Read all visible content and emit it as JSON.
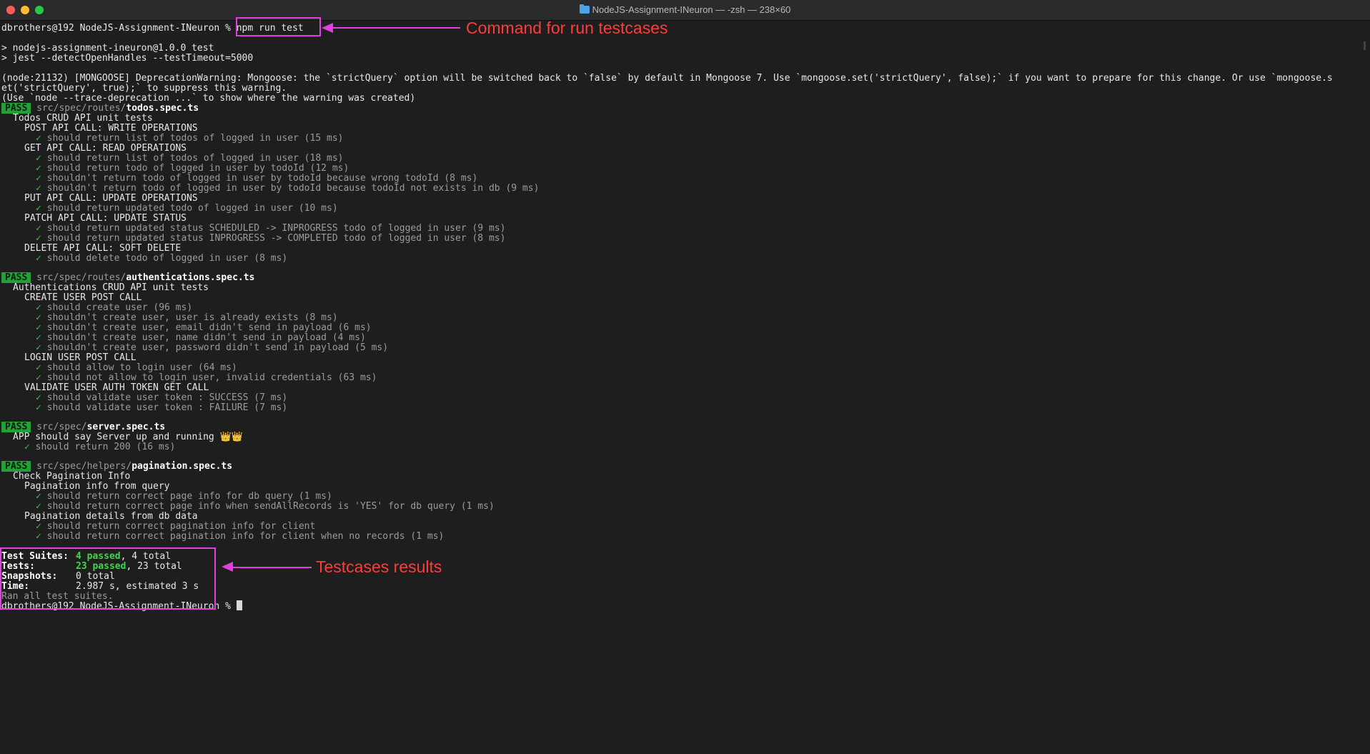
{
  "window": {
    "title": "NodeJS-Assignment-INeuron — -zsh — 238×60"
  },
  "prompt": {
    "text": "dbrothers@192 NodeJS-Assignment-INeuron % ",
    "command": "npm run test"
  },
  "output": {
    "line1": "> nodejs-assignment-ineuron@1.0.0 test",
    "line2": "> jest --detectOpenHandles --testTimeout=5000",
    "warning1": "(node:21132) [MONGOOSE] DeprecationWarning: Mongoose: the `strictQuery` option will be switched back to `false` by default in Mongoose 7. Use `mongoose.set('strictQuery', false);` if you want to prepare for this change. Or use `mongoose.s",
    "warning2": "et('strictQuery', true);` to suppress this warning.",
    "warning3": "(Use `node --trace-deprecation ...` to show where the warning was created)"
  },
  "pass_label": "PASS",
  "check": "✓",
  "suites": {
    "todos": {
      "dir": " src/spec/routes/",
      "file": "todos.spec.ts",
      "describe": "Todos CRUD API unit tests",
      "post": "POST API CALL: WRITE OPERATIONS",
      "post_t1": "should return list of todos of logged in user (15 ms)",
      "get": "GET API CALL: READ OPERATIONS",
      "get_t1": "should return list of todos of logged in user (18 ms)",
      "get_t2": "should return todo of logged in user by todoId (12 ms)",
      "get_t3": "shouldn't return todo of logged in user by todoId because wrong todoId (8 ms)",
      "get_t4": "shouldn't return todo of logged in user by todoId because todoId not exists in db (9 ms)",
      "put": "PUT API CALL: UPDATE OPERATIONS",
      "put_t1": "should return updated todo of logged in user (10 ms)",
      "patch": "PATCH API CALL: UPDATE STATUS",
      "patch_t1": "should return updated status SCHEDULED -> INPROGRESS todo of logged in user (9 ms)",
      "patch_t2": "should return updated status INPROGRESS -> COMPLETED todo of logged in user (8 ms)",
      "delete": "DELETE API CALL: SOFT DELETE",
      "delete_t1": "should delete todo of logged in user (8 ms)"
    },
    "auth": {
      "dir": " src/spec/routes/",
      "file": "authentications.spec.ts",
      "describe": "Authentications CRUD API unit tests",
      "create": "CREATE USER POST CALL",
      "create_t1": "should create user (96 ms)",
      "create_t2": "shouldn't create user, user is already exists (8 ms)",
      "create_t3": "shouldn't create user, email didn't send in payload (6 ms)",
      "create_t4": "shouldn't create user, name didn't send in payload (4 ms)",
      "create_t5": "shouldn't create user, password didn't send in payload (5 ms)",
      "login": "LOGIN USER POST CALL",
      "login_t1": "should allow to login user (64 ms)",
      "login_t2": "should not allow to login user, invalid credentials (63 ms)",
      "validate": "VALIDATE USER AUTH TOKEN GET CALL",
      "validate_t1": "should validate user token : SUCCESS (7 ms)",
      "validate_t2": "should validate user token : FAILURE (7 ms)"
    },
    "server": {
      "dir": " src/spec/",
      "file": "server.spec.ts",
      "describe": "APP should say Server up and running",
      "emoji": "👑👑",
      "t1": "should return 200 (16 ms)"
    },
    "pagination": {
      "dir": " src/spec/helpers/",
      "file": "pagination.spec.ts",
      "describe": "Check Pagination Info",
      "query": "Pagination info from query",
      "query_t1": "should return correct page info for db query (1 ms)",
      "query_t2": "should return correct page info when sendAllRecords is 'YES' for db query (1 ms)",
      "db": "Pagination details from db data",
      "db_t1": "should return correct pagination info for client",
      "db_t2": "should return correct pagination info for client when no records (1 ms)"
    }
  },
  "summary": {
    "suites_label": "Test Suites:",
    "suites_passed": "4 passed",
    "suites_total": ", 4 total",
    "tests_label": "Tests:",
    "tests_passed": "23 passed",
    "tests_total": ", 23 total",
    "snap_label": "Snapshots:",
    "snap_value": "0 total",
    "time_label": "Time:",
    "time_value": "2.987 s, estimated 3 s",
    "ran": "Ran all test suites."
  },
  "annotations": {
    "command": "Command for run testcases",
    "results": "Testcases results"
  },
  "colors": {
    "annotation_text": "#ff3b3b",
    "annotation_box": "#e040e0",
    "pass_bg": "#21a136",
    "check": "#3fbf4a"
  }
}
